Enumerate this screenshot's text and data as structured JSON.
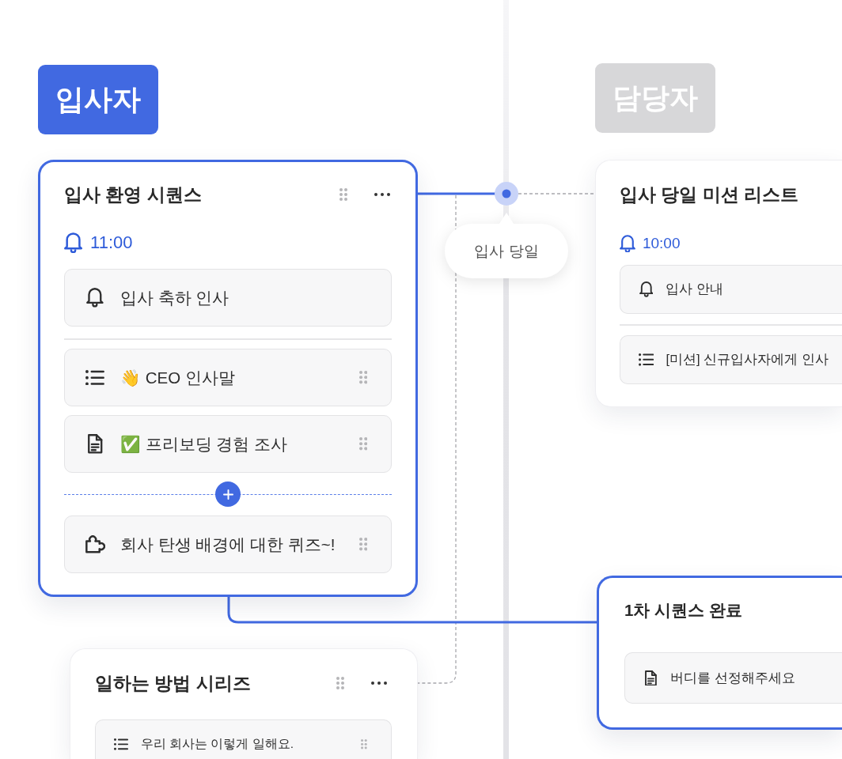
{
  "lanes": [
    {
      "label": "입사자",
      "active": true
    },
    {
      "label": "담당자",
      "active": false
    }
  ],
  "timeline": {
    "marker_label": "입사 당일"
  },
  "cards": [
    {
      "title": "입사 환영 시퀀스",
      "selected": true,
      "header_actions": true,
      "reminder": "11:00",
      "items": [
        {
          "kind": "notification",
          "label": "입사 축하 인사",
          "draggable": false
        },
        {
          "kind": "list",
          "label": "👋 CEO 인사말",
          "draggable": true
        },
        {
          "kind": "document",
          "label": "✅ 프리보딩 경험 조사",
          "draggable": true
        },
        {
          "kind": "insert"
        },
        {
          "kind": "quiz",
          "label": "회사 탄생 배경에 대한 퀴즈~!",
          "draggable": true
        }
      ]
    },
    {
      "title": "입사 당일 미션 리스트",
      "selected": false,
      "reminder": "10:00",
      "items": [
        {
          "kind": "notification",
          "label": "입사 안내"
        },
        {
          "kind": "list",
          "label": "[미션] 신규입사자에게 인사"
        }
      ]
    },
    {
      "title": "1차 시퀀스 완료",
      "selected": true,
      "items": [
        {
          "kind": "document",
          "label": "버디를 선정해주세요"
        }
      ]
    },
    {
      "title": "일하는 방법 시리즈",
      "selected": false,
      "header_actions": true,
      "items": [
        {
          "kind": "list",
          "label": "우리 회사는 이렇게 일해요.",
          "draggable": true
        }
      ]
    }
  ]
}
